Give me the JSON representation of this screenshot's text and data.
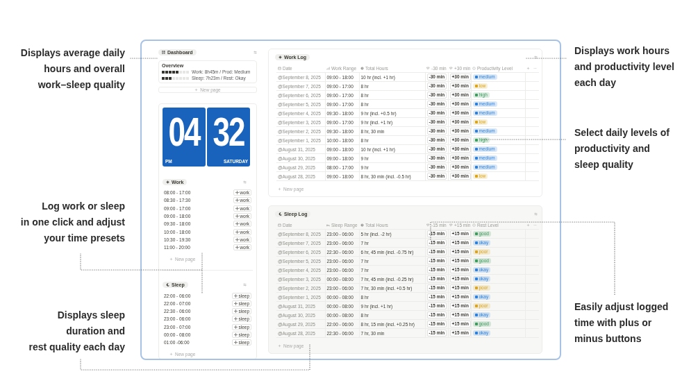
{
  "callouts_left": [
    {
      "lines": [
        "Displays average daily",
        "hours and overall",
        "work–sleep quality"
      ]
    },
    {
      "lines": [
        "Log work or sleep",
        "in one click and adjust",
        "your time presets"
      ]
    },
    {
      "lines": [
        "Displays sleep",
        "duration and",
        "rest quality each day"
      ]
    }
  ],
  "callouts_right": [
    {
      "lines": [
        "Displays work hours",
        "and productivity level",
        "each day"
      ]
    },
    {
      "lines": [
        "Select daily levels of",
        "productivity and",
        "sleep quality"
      ]
    },
    {
      "lines": [
        "Easily adjust logged",
        "time with plus or",
        "minus buttons"
      ]
    }
  ],
  "sidebar": {
    "title": "Dashboard",
    "overview": {
      "title": "Overview",
      "meters": [
        {
          "level": 0.625,
          "text": "Work: 8h45m / Prod: Medium"
        },
        {
          "level": 0.375,
          "text": "Sleep: 7h23m / Rest: Okay"
        }
      ]
    },
    "new_page": "New page",
    "clock": {
      "hour": "04",
      "minute": "32",
      "period": "PM",
      "day": "SATURDAY"
    },
    "presets": [
      {
        "title": "Work",
        "kind": "sun",
        "new_page": "New page",
        "items": [
          {
            "range": "08:00 - 17:00",
            "button": "work"
          },
          {
            "range": "08:30 - 17:30",
            "button": "work"
          },
          {
            "range": "09:00 - 17:00",
            "button": "work"
          },
          {
            "range": "09:00 - 18:00",
            "button": "work"
          },
          {
            "range": "09:30 - 18:00",
            "button": "work"
          },
          {
            "range": "10:00 - 18:00",
            "button": "work"
          },
          {
            "range": "10:30 - 19:30",
            "button": "work"
          },
          {
            "range": "11:00 - 20:00",
            "button": "work"
          }
        ]
      },
      {
        "title": "Sleep",
        "kind": "moon",
        "new_page": "New page",
        "items": [
          {
            "range": "22:00 - 06:00",
            "button": "sleep"
          },
          {
            "range": "22:00 - 07:00",
            "button": "sleep"
          },
          {
            "range": "22:30 - 06:00",
            "button": "sleep"
          },
          {
            "range": "23:00 - 06:00",
            "button": "sleep"
          },
          {
            "range": "23:00 - 07:00",
            "button": "sleep"
          },
          {
            "range": "00:00 - 08:00",
            "button": "sleep"
          },
          {
            "range": "01:00 -06:00",
            "button": "sleep"
          }
        ]
      }
    ]
  },
  "logs": [
    {
      "title": "Work Log",
      "kind": "sun",
      "new_page": "New page",
      "columns": [
        {
          "label": "Date",
          "kind": "calendar"
        },
        {
          "label": "Work Range",
          "kind": "chart"
        },
        {
          "label": "Total Hours",
          "kind": "clock"
        },
        {
          "label": "-30 min",
          "kind": "adjust"
        },
        {
          "label": "+30 min",
          "kind": "adjust"
        },
        {
          "label": "Productivity Level",
          "kind": "status"
        }
      ],
      "rows": [
        {
          "date": "@September 8, 2025",
          "range": "09:00 - 18:00",
          "total": "10 hr (incl. +1 hr)",
          "minus": "-30 min",
          "plus": "+30 min",
          "level": {
            "label": "medium",
            "color": "#2f7fd8"
          }
        },
        {
          "date": "@September 7, 2025",
          "range": "09:00 - 17:00",
          "total": "8 hr",
          "minus": "-30 min",
          "plus": "+30 min",
          "level": {
            "label": "low",
            "color": "#d9a520"
          }
        },
        {
          "date": "@September 6, 2025",
          "range": "09:00 - 17:00",
          "total": "8 hr",
          "minus": "-30 min",
          "plus": "+30 min",
          "level": {
            "label": "high",
            "color": "#3f9a5e"
          }
        },
        {
          "date": "@September 5, 2025",
          "range": "09:00 - 17:00",
          "total": "8 hr",
          "minus": "-30 min",
          "plus": "+30 min",
          "level": {
            "label": "medium",
            "color": "#2f7fd8"
          }
        },
        {
          "date": "@September 4, 2025",
          "range": "09:30 - 18:00",
          "total": "9 hr (incl. +0.5 hr)",
          "minus": "-30 min",
          "plus": "+30 min",
          "level": {
            "label": "medium",
            "color": "#2f7fd8"
          }
        },
        {
          "date": "@September 3, 2025",
          "range": "09:00 - 17:00",
          "total": "9 hr (incl. +1 hr)",
          "minus": "-30 min",
          "plus": "+30 min",
          "level": {
            "label": "low",
            "color": "#d9a520"
          }
        },
        {
          "date": "@September 2, 2025",
          "range": "09:30 - 18:00",
          "total": "8 hr, 30 min",
          "minus": "-30 min",
          "plus": "+30 min",
          "level": {
            "label": "medium",
            "color": "#2f7fd8"
          }
        },
        {
          "date": "@September 1, 2025",
          "range": "10:00 - 18:00",
          "total": "8 hr",
          "minus": "-30 min",
          "plus": "+30 min",
          "level": {
            "label": "high",
            "color": "#3f9a5e"
          }
        },
        {
          "date": "@August 31, 2025",
          "range": "09:00 - 18:00",
          "total": "10 hr (incl. +1 hr)",
          "minus": "-30 min",
          "plus": "+30 min",
          "level": {
            "label": "medium",
            "color": "#2f7fd8"
          }
        },
        {
          "date": "@August 30, 2025",
          "range": "09:00 - 18:00",
          "total": "9 hr",
          "minus": "-30 min",
          "plus": "+30 min",
          "level": {
            "label": "medium",
            "color": "#2f7fd8"
          }
        },
        {
          "date": "@August 29, 2025",
          "range": "08:00 - 17:00",
          "total": "9 hr",
          "minus": "-30 min",
          "plus": "+30 min",
          "level": {
            "label": "medium",
            "color": "#2f7fd8"
          }
        },
        {
          "date": "@August 28, 2025",
          "range": "09:00 - 18:00",
          "total": "8 hr, 30 min (incl. -0.5 hr)",
          "minus": "-30 min",
          "plus": "+30 min",
          "level": {
            "label": "low",
            "color": "#d9a520"
          }
        }
      ]
    },
    {
      "title": "Sleep Log",
      "kind": "moon",
      "new_page": "New page",
      "columns": [
        {
          "label": "Date",
          "kind": "calendar"
        },
        {
          "label": "Sleep Range",
          "kind": "bed"
        },
        {
          "label": "Total Hours",
          "kind": "clock"
        },
        {
          "label": "-15 min",
          "kind": "adjust"
        },
        {
          "label": "+15 min",
          "kind": "adjust"
        },
        {
          "label": "Rest Level",
          "kind": "status"
        }
      ],
      "rows": [
        {
          "date": "@September 8, 2025",
          "range": "23:00 - 06:00",
          "total": "5 hr (incl. -2 hr)",
          "minus": "-15 min",
          "plus": "+15 min",
          "level": {
            "label": "good",
            "color": "#3f9a5e"
          }
        },
        {
          "date": "@September 7, 2025",
          "range": "23:00 - 06:00",
          "total": "7 hr",
          "minus": "-15 min",
          "plus": "+15 min",
          "level": {
            "label": "okay",
            "color": "#2f7fd8"
          }
        },
        {
          "date": "@September 6, 2025",
          "range": "22:30 - 06:00",
          "total": "6 hr, 45 min (incl. -0.75 hr)",
          "minus": "-15 min",
          "plus": "+15 min",
          "level": {
            "label": "poor",
            "color": "#d9a520"
          }
        },
        {
          "date": "@September 5, 2025",
          "range": "23:00 - 06:00",
          "total": "7 hr",
          "minus": "-15 min",
          "plus": "+15 min",
          "level": {
            "label": "good",
            "color": "#3f9a5e"
          }
        },
        {
          "date": "@September 4, 2025",
          "range": "23:00 - 06:00",
          "total": "7 hr",
          "minus": "-15 min",
          "plus": "+15 min",
          "level": {
            "label": "okay",
            "color": "#2f7fd8"
          }
        },
        {
          "date": "@September 3, 2025",
          "range": "00:00 - 08:00",
          "total": "7 hr, 45 min (incl. -0.25 hr)",
          "minus": "-15 min",
          "plus": "+15 min",
          "level": {
            "label": "okay",
            "color": "#2f7fd8"
          }
        },
        {
          "date": "@September 2, 2025",
          "range": "23:00 - 06:00",
          "total": "7 hr, 30 min (incl. +0.5 hr)",
          "minus": "-15 min",
          "plus": "+15 min",
          "level": {
            "label": "poor",
            "color": "#d9a520"
          }
        },
        {
          "date": "@September 1, 2025",
          "range": "00:00 - 08:00",
          "total": "8 hr",
          "minus": "-15 min",
          "plus": "+15 min",
          "level": {
            "label": "okay",
            "color": "#2f7fd8"
          }
        },
        {
          "date": "@August 31, 2025",
          "range": "00:00 - 08:00",
          "total": "9 hr (incl. +1 hr)",
          "minus": "-15 min",
          "plus": "+15 min",
          "level": {
            "label": "poor",
            "color": "#d9a520"
          }
        },
        {
          "date": "@August 30, 2025",
          "range": "00:00 - 08:00",
          "total": "8 hr",
          "minus": "-15 min",
          "plus": "+15 min",
          "level": {
            "label": "okay",
            "color": "#2f7fd8"
          }
        },
        {
          "date": "@August 29, 2025",
          "range": "22:00 - 06:00",
          "total": "8 hr, 15 min (incl. +0.25 hr)",
          "minus": "-15 min",
          "plus": "+15 min",
          "level": {
            "label": "good",
            "color": "#3f9a5e"
          }
        },
        {
          "date": "@August 28, 2025",
          "range": "22:30 - 06:00",
          "total": "7 hr, 30 min",
          "minus": "-15 min",
          "plus": "+15 min",
          "level": {
            "label": "okay",
            "color": "#2f7fd8"
          }
        }
      ]
    }
  ]
}
